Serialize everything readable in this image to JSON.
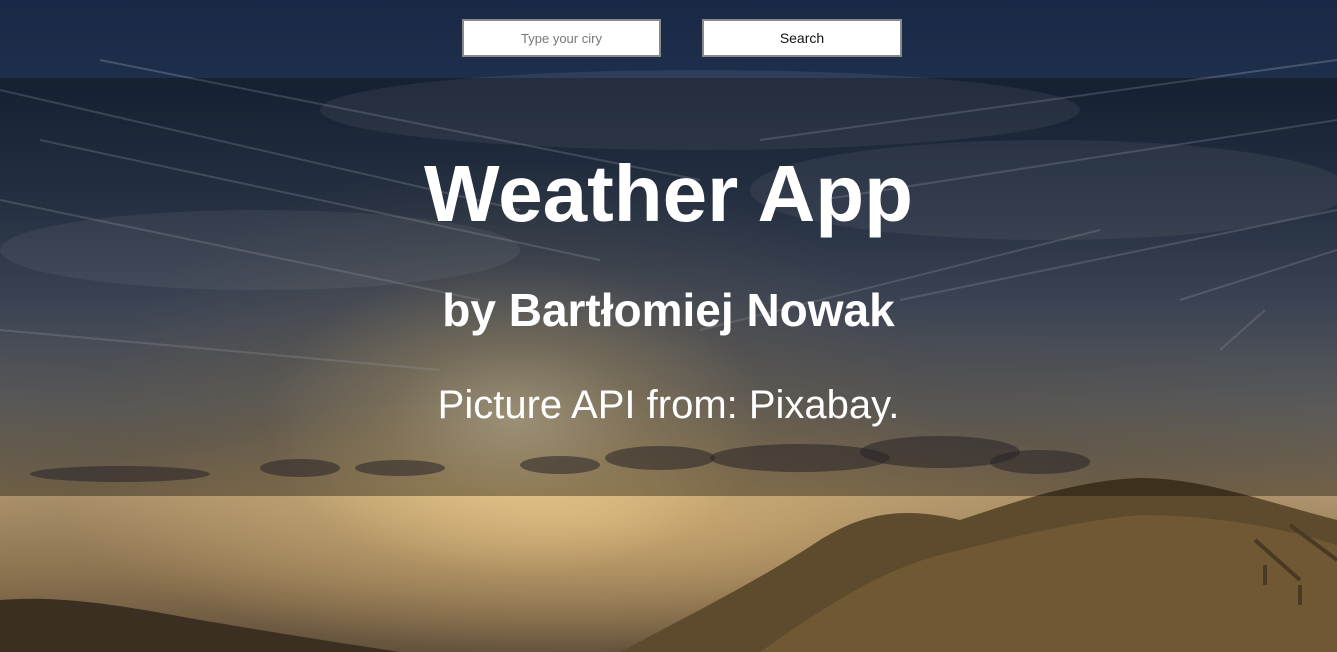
{
  "search": {
    "placeholder": "Type your ciry",
    "value": "",
    "button_label": "Search"
  },
  "header": {
    "title": "Weather App",
    "author": "by Bartłomiej Nowak",
    "credit": "Picture API from: Pixabay."
  },
  "colors": {
    "title_text": "#ffffff",
    "panel_overlay": "rgba(0,0,0,0.35)",
    "input_border": "#8a8a8a"
  }
}
